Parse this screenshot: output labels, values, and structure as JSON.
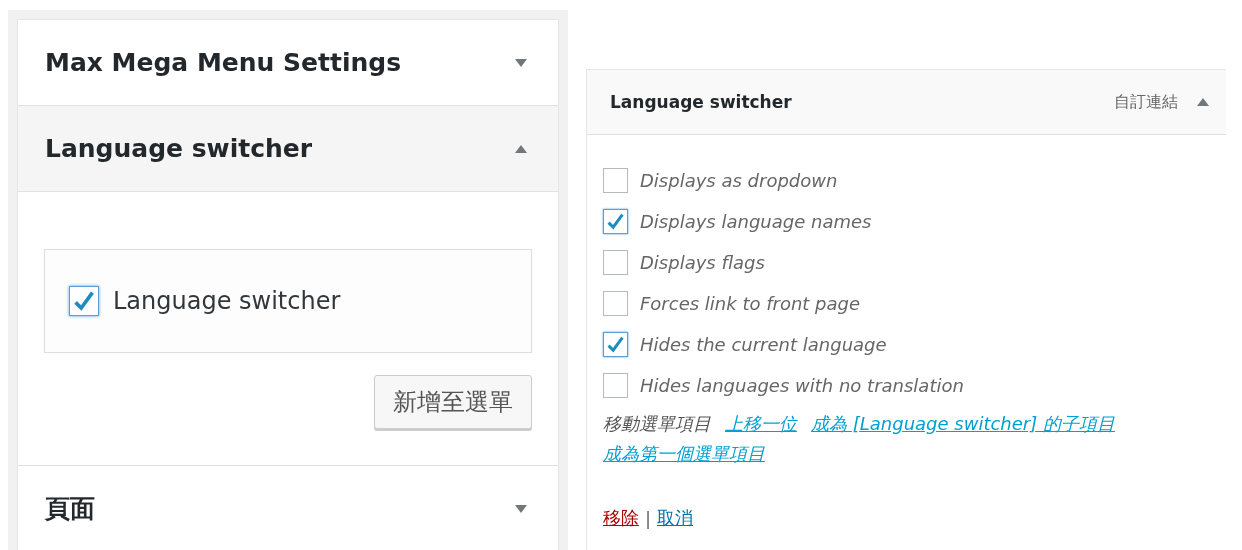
{
  "sections": [
    {
      "title": "Max Mega Menu Settings",
      "expanded": false
    },
    {
      "title": "Language switcher",
      "expanded": true,
      "items": [
        {
          "label": "Language switcher",
          "checked": true
        }
      ],
      "button": "新增至選單"
    },
    {
      "title": "頁面",
      "expanded": false
    }
  ],
  "menu_item": {
    "title": "Language switcher",
    "type": "自訂連結",
    "expanded": true,
    "options": [
      {
        "label": "Displays as dropdown",
        "checked": false
      },
      {
        "label": "Displays language names",
        "checked": true
      },
      {
        "label": "Displays flags",
        "checked": false
      },
      {
        "label": "Forces link to front page",
        "checked": false
      },
      {
        "label": "Hides the current language",
        "checked": true
      },
      {
        "label": "Hides languages with no translation",
        "checked": false
      }
    ],
    "move_label": "移動選單項目",
    "move_links": [
      "上移一位",
      "成為 [Language switcher] 的子項目",
      "成為第一個選單項目"
    ],
    "remove": "移除",
    "separator": "|",
    "cancel": "取消"
  }
}
